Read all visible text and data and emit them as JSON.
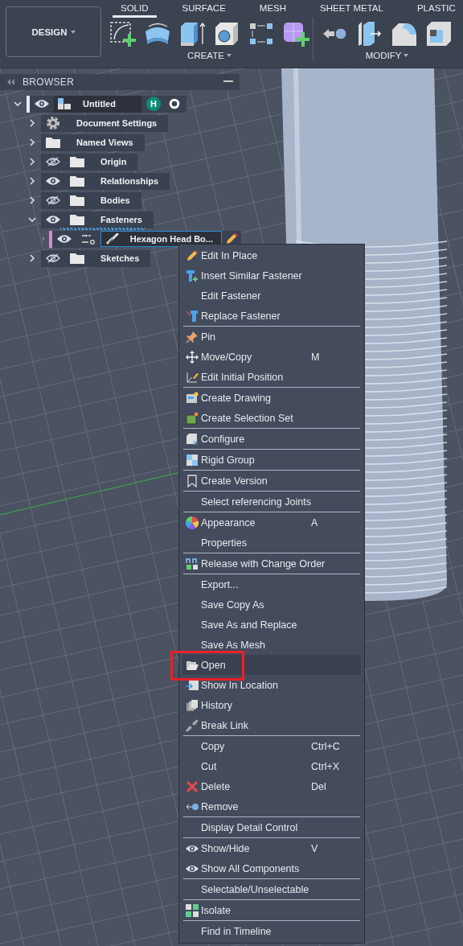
{
  "toolbar": {
    "workspace": "DESIGN",
    "tabs": [
      {
        "label": "SOLID",
        "selected": true
      },
      {
        "label": "SURFACE",
        "selected": false
      },
      {
        "label": "MESH",
        "selected": false
      },
      {
        "label": "SHEET METAL",
        "selected": false
      },
      {
        "label": "PLASTIC",
        "selected": false
      }
    ],
    "groups": [
      {
        "label": "CREATE",
        "tools": [
          {
            "kind": "sketch"
          },
          {
            "kind": "revolve"
          },
          {
            "kind": "extrude"
          },
          {
            "kind": "hole"
          },
          {
            "kind": "pattern"
          },
          {
            "kind": "form"
          }
        ]
      },
      {
        "label": "MODIFY",
        "tools": [
          {
            "kind": "press-pull"
          },
          {
            "kind": "offset"
          },
          {
            "kind": "fillet"
          },
          {
            "kind": "shell"
          }
        ]
      }
    ]
  },
  "browser": {
    "title": "BROWSER",
    "tree": [
      {
        "label": "Untitled",
        "kind": "root",
        "visible": true,
        "expanded": true,
        "selected": false,
        "underlined": false,
        "color": "#e6eaf2",
        "badge": "H",
        "children": [
          {
            "label": "Document Settings",
            "kind": "settings",
            "expanded": false,
            "selected": false,
            "underlined": false
          },
          {
            "label": "Named Views",
            "kind": "views",
            "expanded": false,
            "selected": false,
            "underlined": false
          },
          {
            "label": "Origin",
            "kind": "folder",
            "visible": false,
            "expanded": false,
            "selected": false,
            "underlined": false
          },
          {
            "label": "Relationships",
            "kind": "folder",
            "visible": true,
            "expanded": false,
            "selected": false,
            "underlined": false
          },
          {
            "label": "Bodies",
            "kind": "folder",
            "visible": false,
            "expanded": false,
            "selected": false,
            "underlined": false
          },
          {
            "label": "Fasteners",
            "kind": "folder",
            "visible": true,
            "expanded": true,
            "selected": false,
            "underlined": true,
            "children": [
              {
                "label": "Hexagon Head Bo...",
                "kind": "occurrence",
                "visible": true,
                "expanded": false,
                "selected": true,
                "underlined": false,
                "color": "#d98ad6"
              }
            ]
          },
          {
            "label": "Sketches",
            "kind": "folder",
            "visible": false,
            "expanded": false,
            "selected": false,
            "underlined": false
          }
        ]
      }
    ]
  },
  "context_menu": {
    "sections": [
      [
        {
          "label": "Edit In Place",
          "kind": "pencil",
          "selected": false,
          "annotated": false
        },
        {
          "label": "Insert Similar Fastener",
          "kind": "fastener-plus",
          "selected": false,
          "annotated": false
        },
        {
          "label": "Edit Fastener",
          "kind": "plain",
          "selected": false,
          "annotated": false
        },
        {
          "label": "Replace Fastener",
          "kind": "fastener-swap",
          "selected": false,
          "annotated": false
        }
      ],
      [
        {
          "label": "Pin",
          "kind": "pin",
          "selected": false,
          "annotated": false
        },
        {
          "label": "Move/Copy",
          "shortcut": "M",
          "kind": "move",
          "selected": false,
          "annotated": false
        },
        {
          "label": "Edit Initial Position",
          "kind": "axes",
          "selected": false,
          "annotated": false
        }
      ],
      [
        {
          "label": "Create Drawing",
          "kind": "drawing",
          "selected": false,
          "annotated": false
        },
        {
          "label": "Create Selection Set",
          "kind": "selection-set",
          "selected": false,
          "annotated": false
        }
      ],
      [
        {
          "label": "Configure",
          "kind": "configure",
          "selected": false,
          "annotated": false
        }
      ],
      [
        {
          "label": "Rigid Group",
          "kind": "rigid",
          "selected": false,
          "annotated": false
        }
      ],
      [
        {
          "label": "Create Version",
          "kind": "bookmark",
          "selected": false,
          "annotated": false
        }
      ],
      [
        {
          "label": "Select referencing Joints",
          "kind": "plain",
          "selected": false,
          "annotated": false
        }
      ],
      [
        {
          "label": "Appearance",
          "shortcut": "A",
          "kind": "appearance",
          "selected": false,
          "annotated": false
        },
        {
          "label": "Properties",
          "kind": "plain",
          "selected": false,
          "annotated": false
        }
      ],
      [
        {
          "label": "Release with Change Order",
          "kind": "release",
          "selected": false,
          "annotated": false
        }
      ],
      [
        {
          "label": "Export...",
          "kind": "plain",
          "selected": false,
          "annotated": false
        },
        {
          "label": "Save Copy As",
          "kind": "plain",
          "selected": false,
          "annotated": false
        },
        {
          "label": "Save As and Replace",
          "kind": "plain",
          "selected": false,
          "annotated": false
        },
        {
          "label": "Save As Mesh",
          "kind": "plain",
          "selected": false,
          "annotated": false
        },
        {
          "label": "Open",
          "kind": "folder-open",
          "selected": true,
          "annotated": true
        },
        {
          "label": "Show In Location",
          "kind": "location",
          "selected": false,
          "annotated": false
        },
        {
          "label": "History",
          "kind": "history",
          "selected": false,
          "annotated": false
        },
        {
          "label": "Break Link",
          "kind": "break-link",
          "selected": false,
          "annotated": false
        }
      ],
      [
        {
          "label": "Copy",
          "shortcut": "Ctrl+C",
          "kind": "plain",
          "selected": false,
          "annotated": false
        },
        {
          "label": "Cut",
          "shortcut": "Ctrl+X",
          "kind": "plain",
          "selected": false,
          "annotated": false
        },
        {
          "label": "Delete",
          "shortcut": "Del",
          "kind": "delete",
          "selected": false,
          "annotated": false
        },
        {
          "label": "Remove",
          "kind": "remove",
          "selected": false,
          "annotated": false
        }
      ],
      [
        {
          "label": "Display Detail Control",
          "kind": "plain",
          "selected": false,
          "annotated": false
        }
      ],
      [
        {
          "label": "Show/Hide",
          "shortcut": "V",
          "kind": "eye",
          "selected": false,
          "annotated": false
        },
        {
          "label": "Show All Components",
          "kind": "eye",
          "selected": false,
          "annotated": false
        }
      ],
      [
        {
          "label": "Selectable/Unselectable",
          "kind": "plain",
          "selected": false,
          "annotated": false
        }
      ],
      [
        {
          "label": "Isolate",
          "kind": "isolate",
          "selected": false,
          "annotated": false
        }
      ],
      [
        {
          "label": "Find in Timeline",
          "kind": "plain",
          "selected": false,
          "annotated": false
        }
      ]
    ]
  }
}
